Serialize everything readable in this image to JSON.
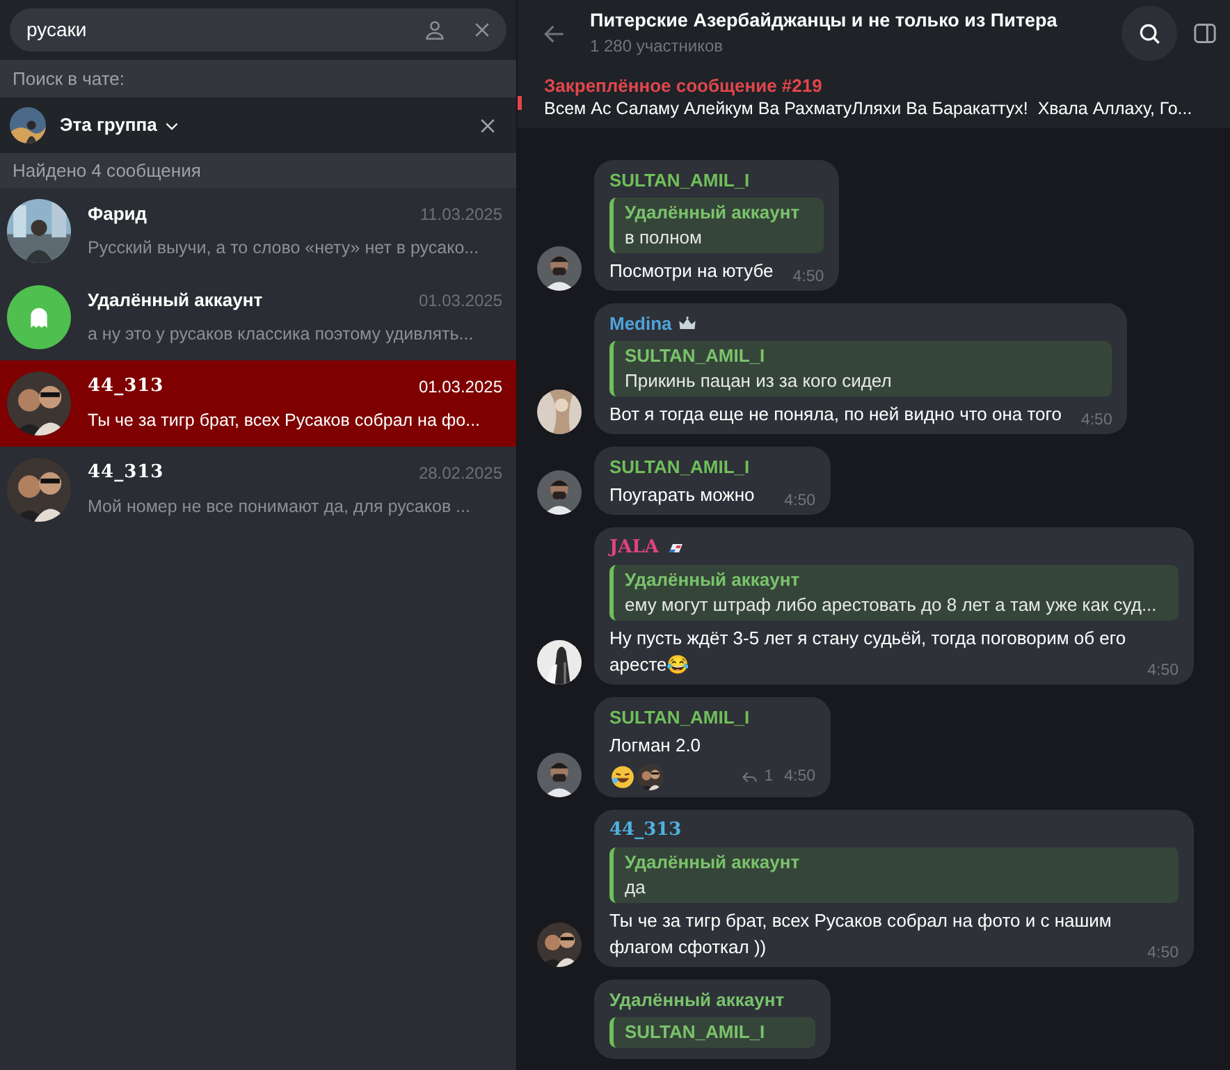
{
  "search": {
    "value": "русаки"
  },
  "search_in_chat": {
    "label": "Поиск в чате:",
    "scope": "Эта группа"
  },
  "results_header": "Найдено 4 сообщения",
  "results": [
    {
      "name": "Фарид",
      "fancy_name": false,
      "date": "11.03.2025",
      "snippet": "Русский выучи, а то слово «нету» нет в русако...",
      "selected": false
    },
    {
      "name": "Удалённый аккаунт",
      "fancy_name": false,
      "date": "01.03.2025",
      "snippet": "а ну это у русаков классика поэтому удивлять...",
      "avatar": {
        "kind": "ghost"
      },
      "selected": false
    },
    {
      "name": "44_313",
      "fancy_name": true,
      "date": "01.03.2025",
      "snippet": "Ты че за тигр брат, всех Русаков собрал на фо...",
      "selected": true
    },
    {
      "name": "44_313",
      "fancy_name": true,
      "date": "28.02.2025",
      "snippet": "Мой номер не все понимают да, для русаков ...",
      "selected": false
    }
  ],
  "chat": {
    "title": "Питерские Азербайджанцы и не только из Питера",
    "subtitle": "1 280 участников"
  },
  "pinned": {
    "title": "Закреплённое сообщение #219",
    "text": "Всем Ас Саламу Алейкум Ва РахматуЛляхи Ва Баракаттух!  Хвала Аллаху, Го..."
  },
  "messages": [
    {
      "sender": "SULTAN_AMIL_I",
      "color": "#6fbf5a",
      "fancy_name": false,
      "reply": {
        "author": "Удалённый аккаунт",
        "text": "в полном"
      },
      "text": "Посмотри на ютубе",
      "time": "4:50"
    },
    {
      "sender": "Medina",
      "color": "#4ea4dc",
      "fancy_name": false,
      "badge": {
        "kind": "crown"
      },
      "reply": {
        "author": "SULTAN_AMIL_I",
        "text": "Прикинь пацан из за кого сидел"
      },
      "text": "Вот я тогда еще не поняла, по ней видно что она того",
      "time": "4:50"
    },
    {
      "sender": "SULTAN_AMIL_I",
      "color": "#6fbf5a",
      "fancy_name": false,
      "text": "Поугарать можно",
      "time": "4:50"
    },
    {
      "sender": "JALA",
      "color": "#e0447c",
      "fancy_name": true,
      "badge": {
        "kind": "flag"
      },
      "reply": {
        "author": "Удалённый аккаунт",
        "text": "ему могут штраф либо арестовать до 8 лет а там уже как суд..."
      },
      "text": "Ну пусть ждёт 3-5 лет я стану судьёй, тогда поговорим об его аресте😂",
      "time": "4:50"
    },
    {
      "sender": "SULTAN_AMIL_I",
      "color": "#6fbf5a",
      "fancy_name": false,
      "text": "Логман 2.0",
      "reactions": [
        {
          "kind": "emoji"
        },
        {
          "kind": "avatar"
        }
      ],
      "reply_count": "1",
      "time": "4:50"
    },
    {
      "sender": "44_313",
      "color": "#4fb2e0",
      "fancy_name": true,
      "reply": {
        "author": "Удалённый аккаунт",
        "text": "да"
      },
      "text": "Ты че за тигр брат, всех Русаков собрал на фото и с нашим флагом сфоткал ))",
      "time": "4:50"
    },
    {
      "sender": "Удалённый аккаунт",
      "color": "#79c36b",
      "fancy_name": false,
      "reply": {
        "author": "SULTAN_AMIL_I"
      }
    }
  ]
}
